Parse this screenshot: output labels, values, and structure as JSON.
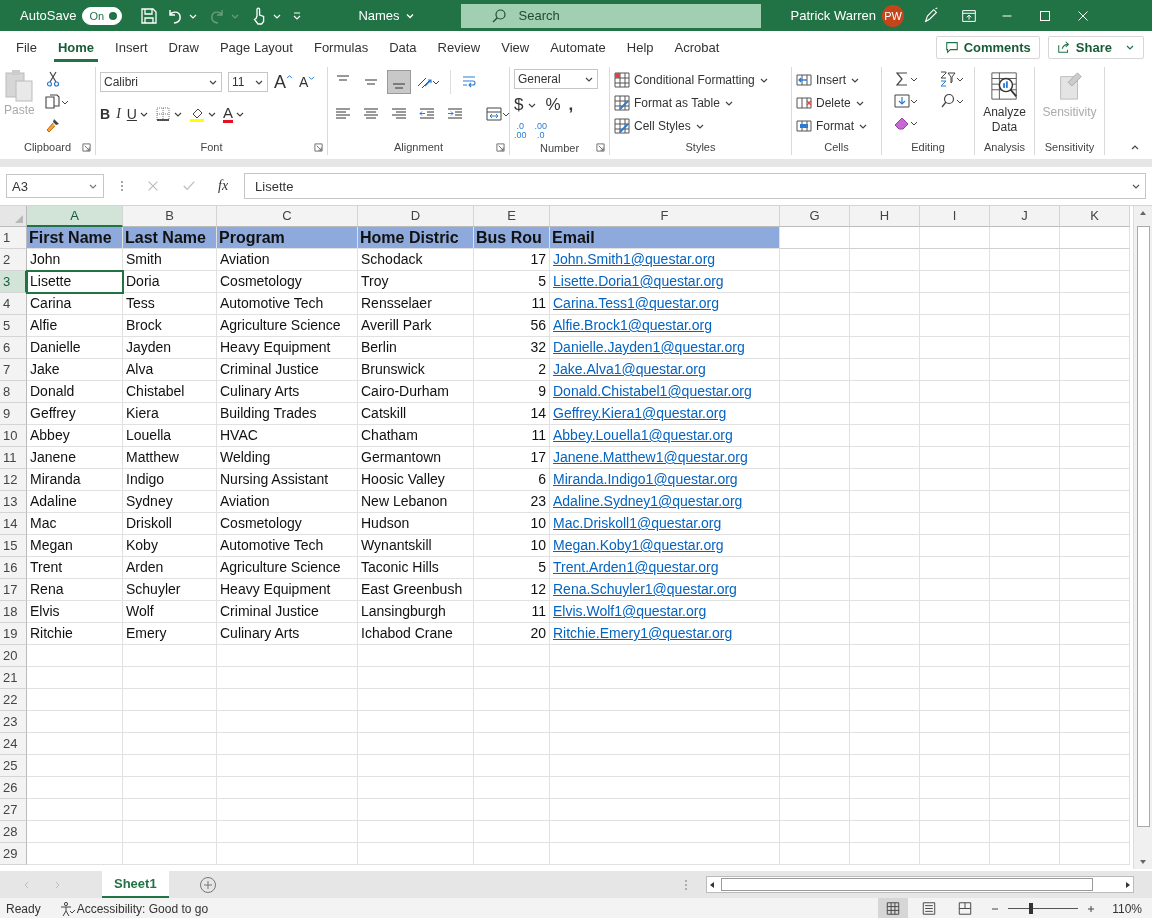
{
  "title_bar": {
    "autosave_label": "AutoSave",
    "autosave": {
      "on": true,
      "text": "On"
    },
    "file_name": "Names",
    "search_placeholder": "Search",
    "user_name": "Patrick Warren",
    "user_initials": "PW"
  },
  "tabs": [
    {
      "label": "File",
      "selected": false
    },
    {
      "label": "Home",
      "selected": true
    },
    {
      "label": "Insert",
      "selected": false
    },
    {
      "label": "Draw",
      "selected": false
    },
    {
      "label": "Page Layout",
      "selected": false
    },
    {
      "label": "Formulas",
      "selected": false
    },
    {
      "label": "Data",
      "selected": false
    },
    {
      "label": "Review",
      "selected": false
    },
    {
      "label": "View",
      "selected": false
    },
    {
      "label": "Automate",
      "selected": false
    },
    {
      "label": "Help",
      "selected": false
    },
    {
      "label": "Acrobat",
      "selected": false
    }
  ],
  "comments_button": "Comments",
  "share_button": "Share",
  "ribbon": {
    "clipboard": {
      "label": "Clipboard",
      "paste": "Paste",
      "paste_disabled": true
    },
    "font": {
      "label": "Font",
      "font_name": "Calibri",
      "font_size": "11",
      "grow": "A",
      "shrink": "A",
      "bold": "B",
      "italic": "I",
      "underline": "U",
      "font_color": "A"
    },
    "alignment": {
      "label": "Alignment",
      "vertical": [
        {
          "selected": false
        },
        {
          "selected": false
        },
        {
          "selected": true
        }
      ]
    },
    "number": {
      "label": "Number",
      "format": "General",
      "currency": "$",
      "percent": "%",
      "comma": ",",
      "decimals": [
        {
          "top": ".0",
          "bottom": ".00"
        },
        {
          "top": ".00",
          "bottom": ".0"
        }
      ]
    },
    "styles": {
      "label": "Styles",
      "items": [
        "Conditional Formatting",
        "Format as Table",
        "Cell Styles"
      ]
    },
    "cells": {
      "label": "Cells",
      "items": [
        "Insert",
        "Delete",
        "Format"
      ]
    },
    "editing": {
      "label": "Editing"
    },
    "analysis": {
      "label": "Analysis",
      "button": "Analyze Data"
    },
    "sensitivity": {
      "label": "Sensitivity",
      "button": "Sensitivity",
      "disabled": true
    }
  },
  "formula_bar": {
    "name_box": "A3",
    "fx": "fx",
    "value": "Lisette"
  },
  "sheet": {
    "columns": [
      {
        "label": "A",
        "selected": true
      },
      {
        "label": "B",
        "selected": false
      },
      {
        "label": "C",
        "selected": false
      },
      {
        "label": "D",
        "selected": false
      },
      {
        "label": "E",
        "selected": false
      },
      {
        "label": "F",
        "selected": false
      },
      {
        "label": "G",
        "selected": false
      },
      {
        "label": "H",
        "selected": false
      },
      {
        "label": "I",
        "selected": false
      },
      {
        "label": "J",
        "selected": false
      },
      {
        "label": "K",
        "selected": false
      }
    ],
    "rows": [
      {
        "number": "1",
        "selected": false,
        "kind": "header",
        "cells": [
          "First Name",
          "Last Name",
          "Program",
          "Home Distric",
          "Bus Rou",
          "Email"
        ]
      },
      {
        "number": "2",
        "selected": false,
        "kind": "data",
        "cells": [
          "John",
          "Smith",
          "Aviation",
          "Schodack",
          "17",
          "John.Smith1@questar.org"
        ]
      },
      {
        "number": "3",
        "selected": true,
        "kind": "data",
        "cells": [
          "Lisette",
          "Doria",
          "Cosmetology",
          "Troy",
          "5",
          "Lisette.Doria1@questar.org"
        ]
      },
      {
        "number": "4",
        "selected": false,
        "kind": "data",
        "cells": [
          "Carina",
          "Tess",
          "Automotive Tech",
          "Rensselaer",
          "11",
          "Carina.Tess1@questar.org"
        ]
      },
      {
        "number": "5",
        "selected": false,
        "kind": "data",
        "cells": [
          "Alfie",
          "Brock",
          "Agriculture Science",
          "Averill Park",
          "56",
          "Alfie.Brock1@questar.org"
        ]
      },
      {
        "number": "6",
        "selected": false,
        "kind": "data",
        "cells": [
          "Danielle",
          "Jayden",
          "Heavy Equipment",
          "Berlin",
          "32",
          "Danielle.Jayden1@questar.org"
        ]
      },
      {
        "number": "7",
        "selected": false,
        "kind": "data",
        "cells": [
          "Jake",
          "Alva",
          "Criminal Justice",
          "Brunswick",
          "2",
          "Jake.Alva1@questar.org"
        ]
      },
      {
        "number": "8",
        "selected": false,
        "kind": "data",
        "cells": [
          "Donald",
          "Chistabel",
          "Culinary Arts",
          "Cairo-Durham",
          "9",
          "Donald.Chistabel1@questar.org"
        ]
      },
      {
        "number": "9",
        "selected": false,
        "kind": "data",
        "cells": [
          "Geffrey",
          "Kiera",
          "Building Trades",
          "Catskill",
          "14",
          "Geffrey.Kiera1@questar.org"
        ]
      },
      {
        "number": "10",
        "selected": false,
        "kind": "data",
        "cells": [
          "Abbey",
          "Louella",
          "HVAC",
          "Chatham",
          "11",
          "Abbey.Louella1@questar.org"
        ]
      },
      {
        "number": "11",
        "selected": false,
        "kind": "data",
        "cells": [
          "Janene",
          "Matthew",
          "Welding",
          "Germantown",
          "17",
          "Janene.Matthew1@questar.org"
        ]
      },
      {
        "number": "12",
        "selected": false,
        "kind": "data",
        "cells": [
          "Miranda",
          "Indigo",
          "Nursing Assistant",
          "Hoosic Valley",
          "6",
          "Miranda.Indigo1@questar.org"
        ]
      },
      {
        "number": "13",
        "selected": false,
        "kind": "data",
        "cells": [
          "Adaline",
          "Sydney",
          "Aviation",
          "New Lebanon",
          "23",
          "Adaline.Sydney1@questar.org"
        ]
      },
      {
        "number": "14",
        "selected": false,
        "kind": "data",
        "cells": [
          "Mac",
          "Driskoll",
          "Cosmetology",
          "Hudson",
          "10",
          "Mac.Driskoll1@questar.org"
        ]
      },
      {
        "number": "15",
        "selected": false,
        "kind": "data",
        "cells": [
          "Megan",
          "Koby",
          "Automotive Tech",
          "Wynantskill",
          "10",
          "Megan.Koby1@questar.org"
        ]
      },
      {
        "number": "16",
        "selected": false,
        "kind": "data",
        "cells": [
          "Trent",
          "Arden",
          "Agriculture Science",
          "Taconic Hills",
          "5",
          "Trent.Arden1@questar.org"
        ]
      },
      {
        "number": "17",
        "selected": false,
        "kind": "data",
        "cells": [
          "Rena",
          "Schuyler",
          "Heavy Equipment",
          "East Greenbush",
          "12",
          "Rena.Schuyler1@questar.org"
        ]
      },
      {
        "number": "18",
        "selected": false,
        "kind": "data",
        "cells": [
          "Elvis",
          "Wolf",
          "Criminal Justice",
          "Lansingburgh",
          "11",
          "Elvis.Wolf1@questar.org"
        ]
      },
      {
        "number": "19",
        "selected": false,
        "kind": "data",
        "cells": [
          "Ritchie",
          "Emery",
          "Culinary Arts",
          "Ichabod Crane",
          "20",
          "Ritchie.Emery1@questar.org"
        ]
      },
      {
        "number": "20",
        "selected": false,
        "kind": "data"
      },
      {
        "number": "21",
        "selected": false,
        "kind": "data"
      },
      {
        "number": "22",
        "selected": false,
        "kind": "data"
      },
      {
        "number": "23",
        "selected": false,
        "kind": "data"
      },
      {
        "number": "24",
        "selected": false,
        "kind": "data"
      },
      {
        "number": "25",
        "selected": false,
        "kind": "data"
      },
      {
        "number": "26",
        "selected": false,
        "kind": "data"
      },
      {
        "number": "27",
        "selected": false,
        "kind": "data"
      },
      {
        "number": "28",
        "selected": false,
        "kind": "data"
      },
      {
        "number": "29",
        "selected": false,
        "kind": "data"
      }
    ],
    "sheet_tabs": [
      {
        "label": "Sheet1",
        "selected": true
      }
    ]
  },
  "status_bar": {
    "ready": "Ready",
    "accessibility": "Accessibility: Good to go",
    "views": [
      {
        "selected": true
      },
      {
        "selected": false
      },
      {
        "selected": false
      }
    ],
    "zoom": {
      "level": 0.33,
      "text": "110%"
    }
  }
}
